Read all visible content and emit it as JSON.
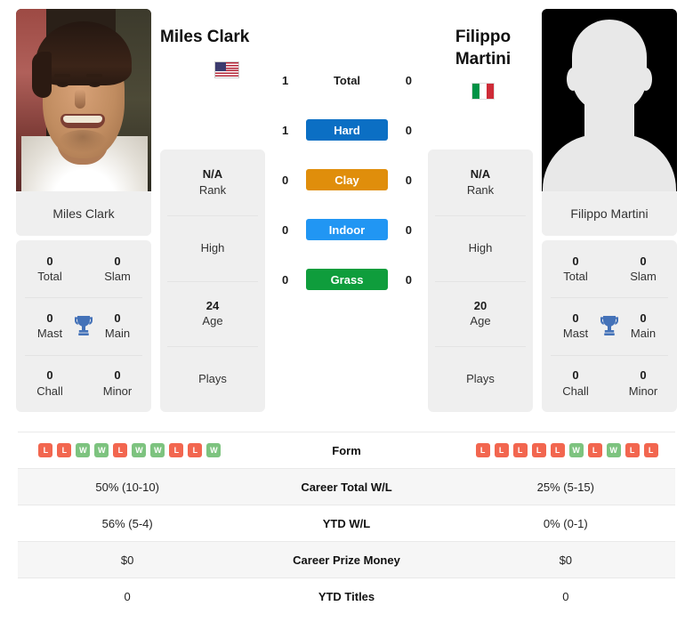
{
  "colors": {
    "hard": "#0b6fc4",
    "clay": "#e08e0b",
    "indoor": "#2196f3",
    "grass": "#0f9d3c",
    "win": "#7dc37f",
    "loss": "#f2664f",
    "trophy": "#4472b8",
    "card_bg": "#efefef"
  },
  "player_left": {
    "name": "Miles Clark",
    "caption": "Miles Clark",
    "flag": "us-flag-icon",
    "rank_value": "N/A",
    "rank_label": "Rank",
    "high_label": "High",
    "age_value": "24",
    "age_label": "Age",
    "plays_label": "Plays",
    "titles": [
      {
        "value": "0",
        "label": "Total"
      },
      {
        "value": "0",
        "label": "Slam"
      },
      {
        "value": "0",
        "label": "Mast"
      },
      {
        "value": "0",
        "label": "Main"
      },
      {
        "value": "0",
        "label": "Chall"
      },
      {
        "value": "0",
        "label": "Minor"
      }
    ]
  },
  "player_right": {
    "name_line1": "Filippo",
    "name_line2": "Martini",
    "caption": "Filippo Martini",
    "flag": "it-flag-icon",
    "rank_value": "N/A",
    "rank_label": "Rank",
    "high_label": "High",
    "age_value": "20",
    "age_label": "Age",
    "plays_label": "Plays",
    "titles": [
      {
        "value": "0",
        "label": "Total"
      },
      {
        "value": "0",
        "label": "Slam"
      },
      {
        "value": "0",
        "label": "Mast"
      },
      {
        "value": "0",
        "label": "Main"
      },
      {
        "value": "0",
        "label": "Chall"
      },
      {
        "value": "0",
        "label": "Minor"
      }
    ]
  },
  "surfaces": [
    {
      "label": "Total",
      "left": "1",
      "right": "0",
      "badge": false
    },
    {
      "label": "Hard",
      "left": "1",
      "right": "0",
      "badge": true,
      "color": "#0b6fc4"
    },
    {
      "label": "Clay",
      "left": "0",
      "right": "0",
      "badge": true,
      "color": "#e08e0b"
    },
    {
      "label": "Indoor",
      "left": "0",
      "right": "0",
      "badge": true,
      "color": "#2196f3"
    },
    {
      "label": "Grass",
      "left": "0",
      "right": "0",
      "badge": true,
      "color": "#0f9d3c"
    }
  ],
  "table": {
    "form_label": "Form",
    "form_left": [
      "L",
      "L",
      "W",
      "W",
      "L",
      "W",
      "W",
      "L",
      "L",
      "W"
    ],
    "form_right": [
      "L",
      "L",
      "L",
      "L",
      "L",
      "W",
      "L",
      "W",
      "L",
      "L"
    ],
    "rows": [
      {
        "label": "Career Total W/L",
        "left": "50% (10-10)",
        "right": "25% (5-15)"
      },
      {
        "label": "YTD W/L",
        "left": "56% (5-4)",
        "right": "0% (0-1)"
      },
      {
        "label": "Career Prize Money",
        "left": "$0",
        "right": "$0"
      },
      {
        "label": "YTD Titles",
        "left": "0",
        "right": "0"
      }
    ]
  }
}
